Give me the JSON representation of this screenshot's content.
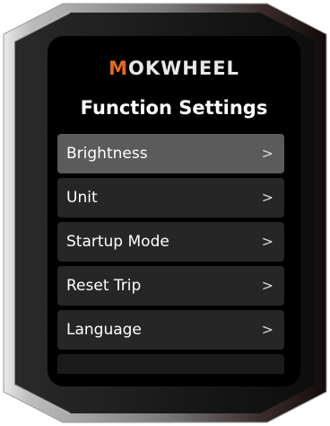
{
  "device": {
    "brand_prefix": "M",
    "brand_rest": "OKWHEEL",
    "accent_color": "#e36a1c"
  },
  "screen": {
    "title": "Function Settings"
  },
  "menu": {
    "items": [
      {
        "label": "Brightness",
        "chevron": ">",
        "selected": true
      },
      {
        "label": "Unit",
        "chevron": ">",
        "selected": false
      },
      {
        "label": "Startup Mode",
        "chevron": ">",
        "selected": false
      },
      {
        "label": "Reset Trip",
        "chevron": ">",
        "selected": false
      },
      {
        "label": "Language",
        "chevron": ">",
        "selected": false
      }
    ]
  },
  "colors": {
    "selected_row": "#5b5b5b",
    "row": "#262626",
    "screen_bg": "#000000"
  }
}
